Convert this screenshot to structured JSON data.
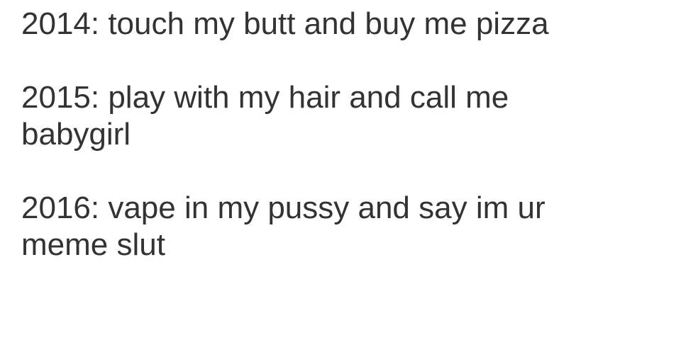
{
  "entries": [
    {
      "lines": [
        "2014: touch my butt and buy me pizza"
      ]
    },
    {
      "lines": [
        "2015: play with my hair and call me",
        "babygirl"
      ]
    },
    {
      "lines": [
        "2016: vape in my pussy and say im ur",
        "meme slut"
      ]
    }
  ],
  "colors": {
    "background": "#ffffff",
    "text": "#333333"
  }
}
